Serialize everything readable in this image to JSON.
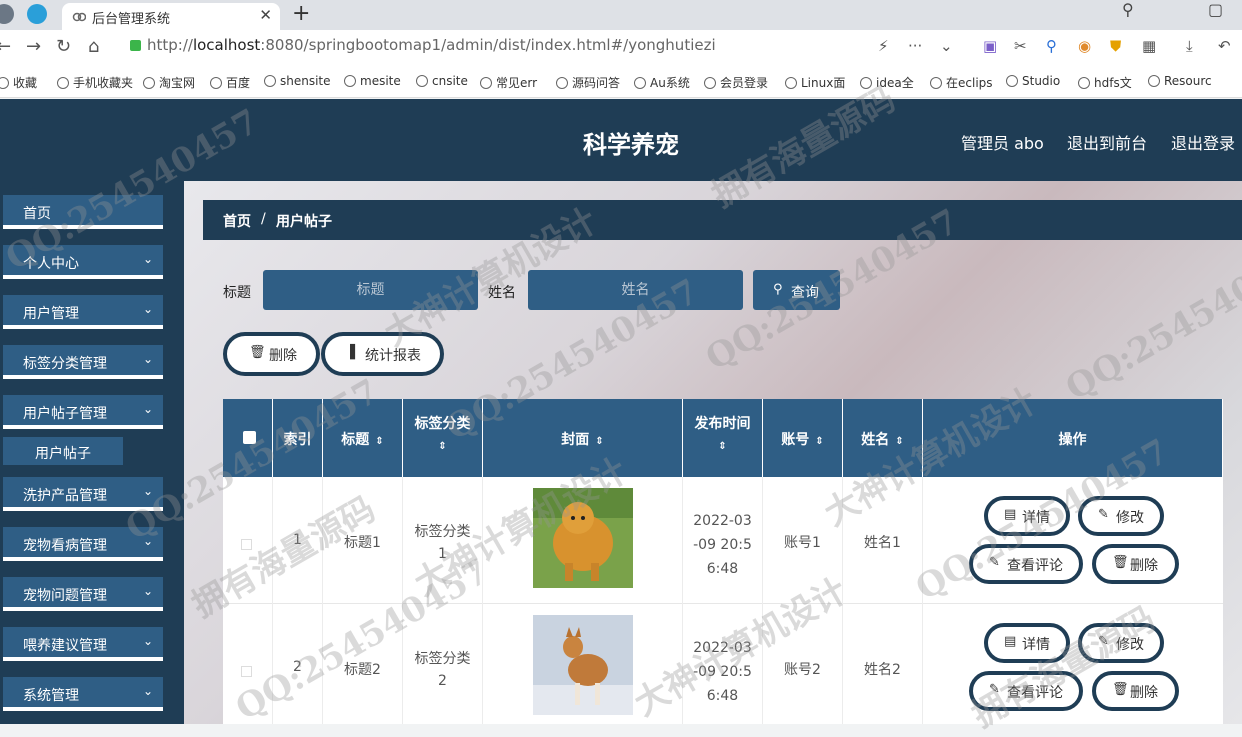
{
  "browser": {
    "tab_title": "后台管理系统",
    "url_prefix": "http://",
    "url_host": "localhost",
    "url_rest": ":8080/springbootomap1/admin/dist/index.html#/yonghutiezi",
    "bookmarks": [
      "收藏",
      "手机收藏夹",
      "淘宝网",
      "百度",
      "shensite",
      "mesite",
      "cnsite",
      "常见err",
      "源码问答",
      "Au系统",
      "会员登录",
      "Linux面",
      "idea全",
      "在eclips",
      "Studio",
      "hdfs文",
      "Resourc"
    ]
  },
  "header": {
    "title": "科学养宠",
    "admin": "管理员 abo",
    "to_front": "退出到前台",
    "logout": "退出登录"
  },
  "sidebar": {
    "items": [
      {
        "label": "首页"
      },
      {
        "label": "个人中心"
      },
      {
        "label": "用户管理"
      },
      {
        "label": "标签分类管理"
      },
      {
        "label": "用户帖子管理"
      },
      {
        "label": "洗护产品管理"
      },
      {
        "label": "宠物看病管理"
      },
      {
        "label": "宠物问题管理"
      },
      {
        "label": "喂养建议管理"
      },
      {
        "label": "系统管理"
      }
    ],
    "sub_active": "用户帖子"
  },
  "breadcrumb": {
    "home": "首页",
    "sep": "/",
    "current": "用户帖子"
  },
  "search": {
    "title_label": "标题",
    "title_placeholder": "标题",
    "name_label": "姓名",
    "name_placeholder": "姓名",
    "query_button": "查询"
  },
  "actions": {
    "delete": "删除",
    "report": "统计报表"
  },
  "table": {
    "headers": {
      "index": "索引",
      "title": "标题",
      "category": "标签分类",
      "cover": "封面",
      "publish_time": "发布时间",
      "account": "账号",
      "name": "姓名",
      "operations": "操作"
    },
    "rows": [
      {
        "index": "1",
        "title": "标题1",
        "category_1": "标签分类",
        "category_2": "1",
        "time_1": "2022-03",
        "time_2": "-09 20:5",
        "time_3": "6:48",
        "account": "账号1",
        "name": "姓名1"
      },
      {
        "index": "2",
        "title": "标题2",
        "category_1": "标签分类",
        "category_2": "2",
        "time_1": "2022-03",
        "time_2": "-09 20:5",
        "time_3": "6:48",
        "account": "账号2",
        "name": "姓名2"
      }
    ],
    "row_buttons": {
      "detail": "详情",
      "edit": "修改",
      "comments": "查看评论",
      "delete": "删除"
    }
  },
  "watermarks": [
    "QQ:254540457",
    "大神计算机设计",
    "拥有海量源码"
  ]
}
